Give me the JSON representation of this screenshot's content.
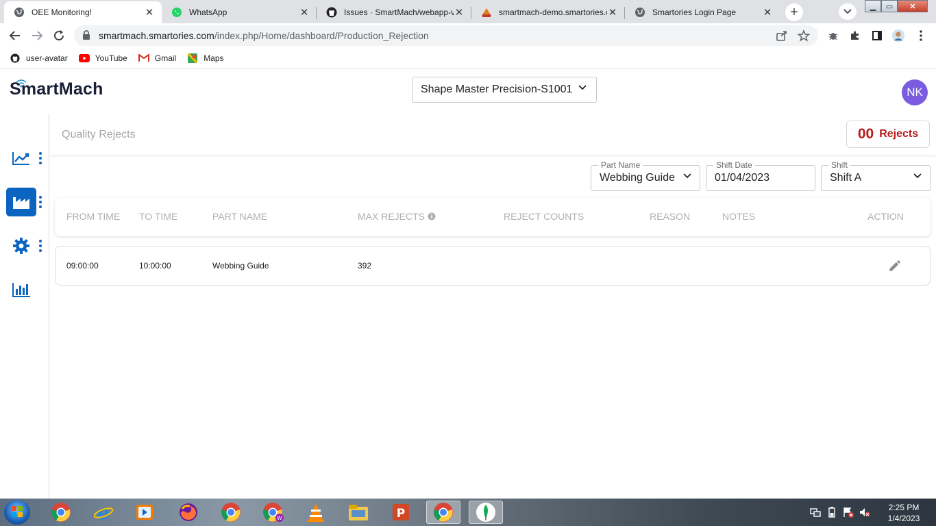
{
  "browser": {
    "tabs": [
      {
        "title": "OEE Monitoring!",
        "active": true,
        "icon": "globe-icon"
      },
      {
        "title": "WhatsApp",
        "active": false,
        "icon": "whatsapp-icon"
      },
      {
        "title": "Issues · SmartMach/webapp-v",
        "active": false,
        "icon": "github-icon"
      },
      {
        "title": "smartmach-demo.smartories.c",
        "active": false,
        "icon": "pma-icon"
      },
      {
        "title": "Smartories Login Page",
        "active": false,
        "icon": "globe-icon"
      }
    ],
    "url_host": "smartmach.smartories.com",
    "url_path": "/index.php/Home/dashboard/Production_Rejection",
    "bookmarks": [
      {
        "label": "user-avatar",
        "icon": "github-icon"
      },
      {
        "label": "YouTube",
        "icon": "youtube-icon"
      },
      {
        "label": "Gmail",
        "icon": "gmail-icon"
      },
      {
        "label": "Maps",
        "icon": "maps-icon"
      }
    ]
  },
  "header": {
    "logo_text": "SmartMach",
    "machine_selected": "Shape Master Precision-S1001",
    "avatar_initials": "NK",
    "avatar_color": "#7b5ce0"
  },
  "sidebar": {
    "items": [
      {
        "name": "trend-chart-icon",
        "active": false
      },
      {
        "name": "factory-icon",
        "active": true
      },
      {
        "name": "gear-icon",
        "active": false
      },
      {
        "name": "bar-chart-icon",
        "active": false
      }
    ],
    "accent_color": "#0b64c0"
  },
  "main": {
    "page_title": "Quality Rejects",
    "rejects_count": "00",
    "rejects_label": "Rejects",
    "rejects_color": "#b51a1a",
    "filters": {
      "part_name_label": "Part Name",
      "part_name_value": "Webbing Guide",
      "shift_date_label": "Shift Date",
      "shift_date_value": "01/04/2023",
      "shift_label": "Shift",
      "shift_value": "Shift A"
    },
    "table": {
      "columns": [
        "FROM TIME",
        "TO TIME",
        "PART NAME",
        "MAX REJECTS",
        "REJECT COUNTS",
        "REASON",
        "NOTES",
        "ACTION"
      ],
      "rows": [
        {
          "from_time": "09:00:00",
          "to_time": "10:00:00",
          "part_name": "Webbing Guide",
          "max_rejects": "392",
          "reject_counts": "",
          "reason": "",
          "notes": ""
        }
      ]
    }
  },
  "taskbar": {
    "time": "2:25 PM",
    "date": "1/4/2023"
  }
}
